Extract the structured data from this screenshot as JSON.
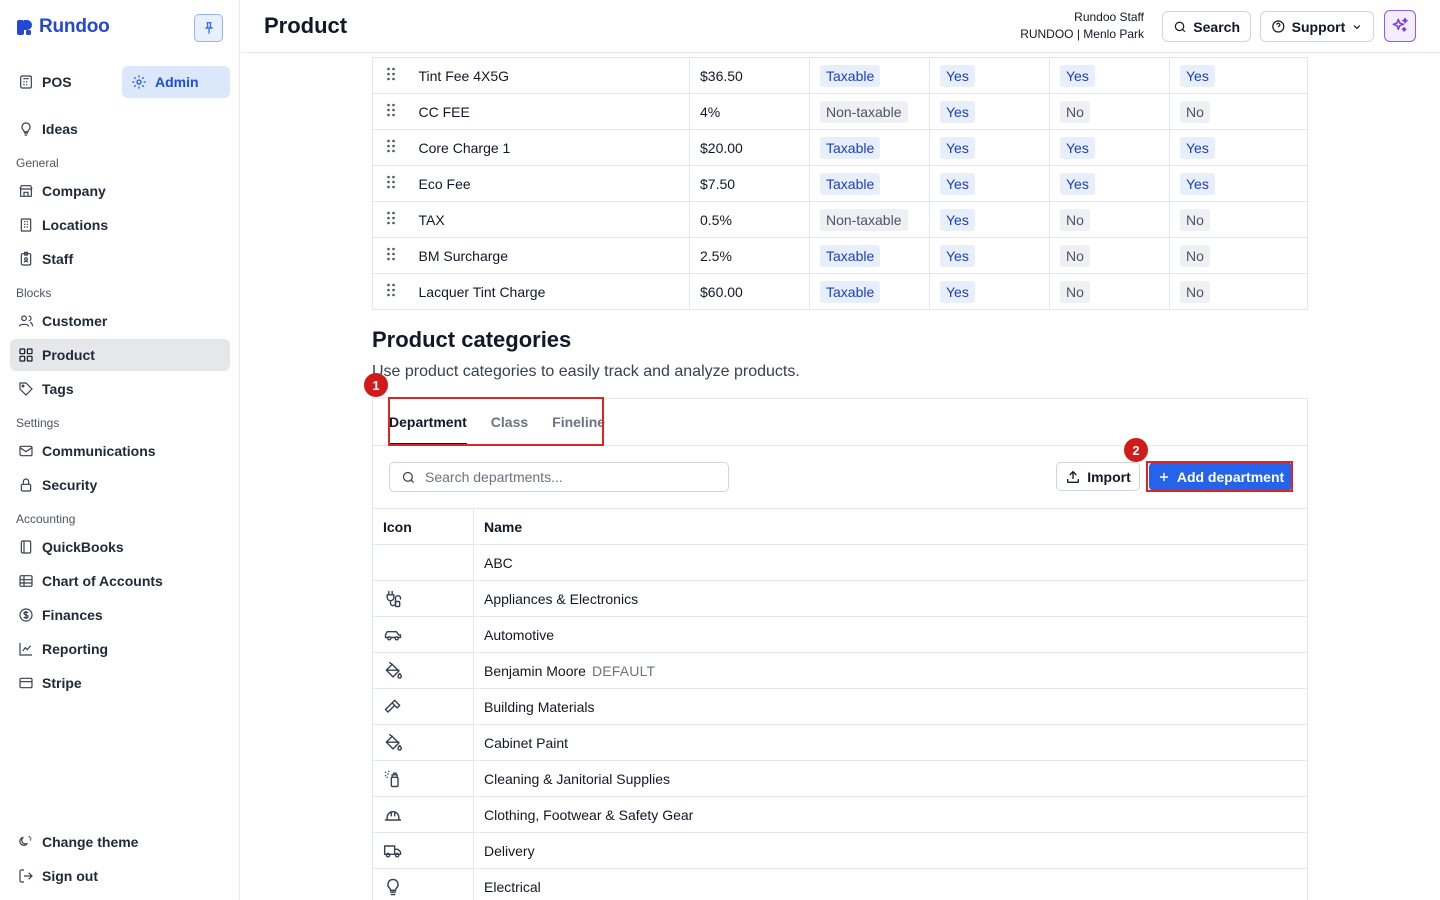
{
  "sidebar": {
    "brand": "Rundoo",
    "modes": {
      "pos": "POS",
      "admin": "Admin"
    },
    "ideas": "Ideas",
    "sections": {
      "general": "General",
      "blocks": "Blocks",
      "settings": "Settings",
      "accounting": "Accounting"
    },
    "general_items": [
      "Company",
      "Locations",
      "Staff"
    ],
    "blocks_items": [
      "Customer",
      "Product",
      "Tags"
    ],
    "settings_items": [
      "Communications",
      "Security"
    ],
    "accounting_items": [
      "QuickBooks",
      "Chart of Accounts",
      "Finances",
      "Reporting",
      "Stripe"
    ],
    "bottom": {
      "theme": "Change theme",
      "signout": "Sign out"
    }
  },
  "header": {
    "title": "Product",
    "user_name": "Rundoo Staff",
    "user_store": "RUNDOO | Menlo Park",
    "search": "Search",
    "support": "Support"
  },
  "charges": [
    {
      "name": "Tint Fee 4X5G",
      "amount": "$36.50",
      "tax": "Taxable",
      "a": "Yes",
      "b": "Yes",
      "c": "Yes"
    },
    {
      "name": "CC FEE",
      "amount": "4%",
      "tax": "Non-taxable",
      "a": "Yes",
      "b": "No",
      "c": "No"
    },
    {
      "name": "Core Charge 1",
      "amount": "$20.00",
      "tax": "Taxable",
      "a": "Yes",
      "b": "Yes",
      "c": "Yes"
    },
    {
      "name": "Eco Fee",
      "amount": "$7.50",
      "tax": "Taxable",
      "a": "Yes",
      "b": "Yes",
      "c": "Yes"
    },
    {
      "name": "TAX",
      "amount": "0.5%",
      "tax": "Non-taxable",
      "a": "Yes",
      "b": "No",
      "c": "No"
    },
    {
      "name": "BM Surcharge",
      "amount": "2.5%",
      "tax": "Taxable",
      "a": "Yes",
      "b": "No",
      "c": "No"
    },
    {
      "name": "Lacquer Tint Charge",
      "amount": "$60.00",
      "tax": "Taxable",
      "a": "Yes",
      "b": "No",
      "c": "No"
    }
  ],
  "categories": {
    "title": "Product categories",
    "description": "Use product categories to easily track and analyze products.",
    "tabs": [
      "Department",
      "Class",
      "Fineline"
    ],
    "search_placeholder": "Search departments...",
    "import": "Import",
    "add": "Add department",
    "columns": {
      "icon": "Icon",
      "name": "Name"
    },
    "default_label": "DEFAULT",
    "departments": [
      {
        "name": "ABC",
        "icon": "none"
      },
      {
        "name": "Appliances & Electronics",
        "icon": "plug-icon"
      },
      {
        "name": "Automotive",
        "icon": "car-icon"
      },
      {
        "name": "Benjamin Moore",
        "icon": "paint-bucket-icon",
        "default": true
      },
      {
        "name": "Building Materials",
        "icon": "hammer-icon"
      },
      {
        "name": "Cabinet Paint",
        "icon": "paint-bucket-icon"
      },
      {
        "name": "Cleaning & Janitorial Supplies",
        "icon": "spray-bottle-icon"
      },
      {
        "name": "Clothing, Footwear & Safety Gear",
        "icon": "hard-hat-icon"
      },
      {
        "name": "Delivery",
        "icon": "truck-icon"
      },
      {
        "name": "Electrical",
        "icon": "lightbulb-icon"
      }
    ]
  },
  "annotations": [
    "1",
    "2"
  ],
  "colors": {
    "accent": "#2563eb",
    "brand": "#2447d6",
    "annotation": "#dc2626"
  }
}
